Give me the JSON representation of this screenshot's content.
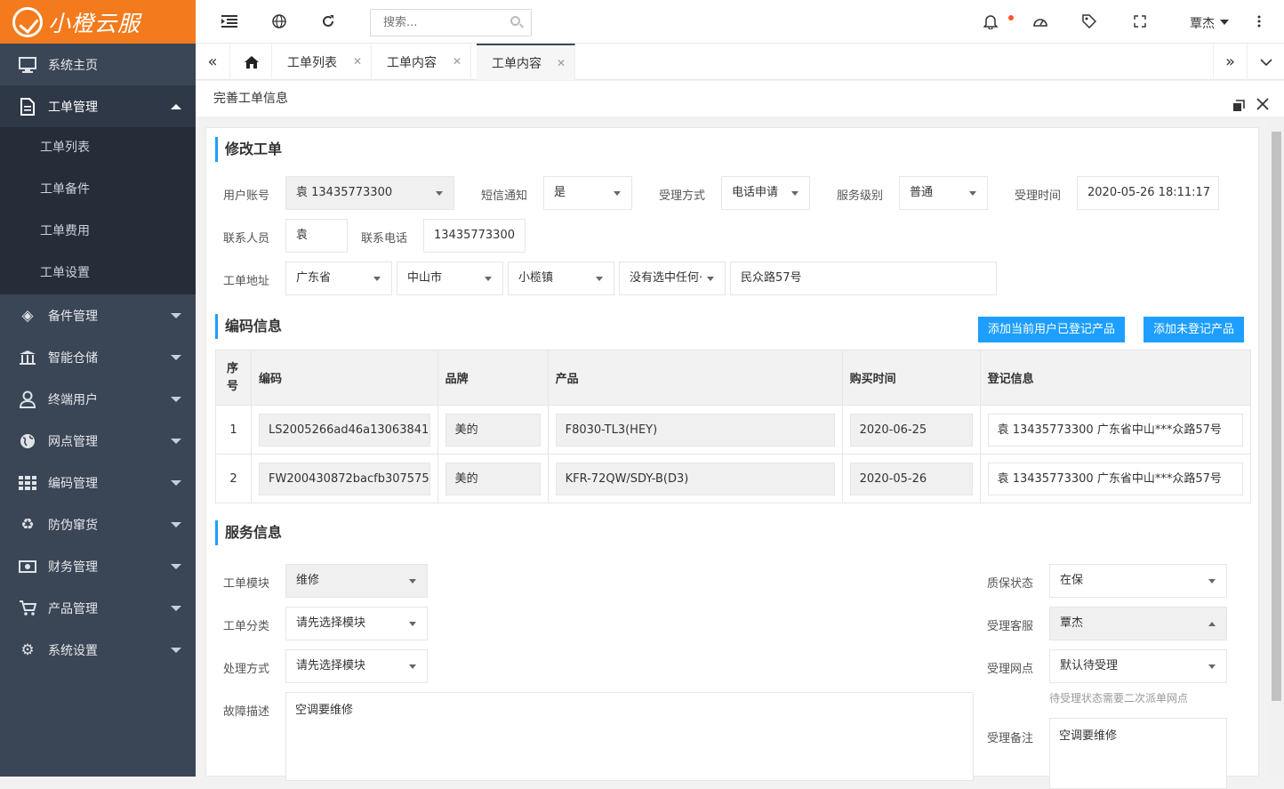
{
  "app": {
    "logo_text": "小橙云服"
  },
  "sidebar": {
    "items": [
      {
        "label": "系统主页",
        "icon": "monitor-icon"
      },
      {
        "label": "工单管理",
        "icon": "document-icon"
      },
      {
        "label": "备件管理",
        "icon": "sparepart-icon"
      },
      {
        "label": "智能仓储",
        "icon": "warehouse-icon"
      },
      {
        "label": "终端用户",
        "icon": "user-icon"
      },
      {
        "label": "网点管理",
        "icon": "globe-icon"
      },
      {
        "label": "编码管理",
        "icon": "grid-icon"
      },
      {
        "label": "防伪窜货",
        "icon": "recycle-icon"
      },
      {
        "label": "财务管理",
        "icon": "money-icon"
      },
      {
        "label": "产品管理",
        "icon": "cart-icon"
      },
      {
        "label": "系统设置",
        "icon": "gear-icon"
      }
    ],
    "sub_items": [
      "工单列表",
      "工单备件",
      "工单费用",
      "工单设置"
    ]
  },
  "topbar": {
    "search_placeholder": "搜索...",
    "user_name": "覃杰"
  },
  "tabs": [
    {
      "label": "工单列表"
    },
    {
      "label": "工单内容"
    },
    {
      "label": "工单内容",
      "active": true
    }
  ],
  "page": {
    "title": "完善工单信息"
  },
  "section_edit": {
    "title": "修改工单",
    "fields": {
      "user_account_label": "用户账号",
      "user_account_value": "袁 13435773300",
      "sms_label": "短信通知",
      "sms_value": "是",
      "accept_method_label": "受理方式",
      "accept_method_value": "电话申请",
      "service_level_label": "服务级别",
      "service_level_value": "普通",
      "accept_time_label": "受理时间",
      "accept_time_value": "2020-05-26 18:11:17",
      "contact_label": "联系人员",
      "contact_value": "袁",
      "phone_label": "联系电话",
      "phone_value": "13435773300",
      "address_label": "工单地址",
      "province": "广东省",
      "city": "中山市",
      "town": "小榄镇",
      "village": "没有选中任何·",
      "street": "民众路57号"
    }
  },
  "section_codes": {
    "title": "编码信息",
    "btn_add_registered": "添加当前用户已登记产品",
    "btn_add_unregistered": "添加未登记产品",
    "columns": [
      "序号",
      "编码",
      "品牌",
      "产品",
      "购买时间",
      "登记信息"
    ],
    "rows": [
      {
        "no": "1",
        "code": "LS2005266ad46a13063841",
        "brand": "美的",
        "product": "F8030-TL3(HEY)",
        "date": "2020-06-25",
        "reg": "袁  13435773300  广东省中山***众路57号"
      },
      {
        "no": "2",
        "code": "FW200430872bacfb307575",
        "brand": "美的",
        "product": "KFR-72QW/SDY-B(D3)",
        "date": "2020-05-26",
        "reg": "袁  13435773300  广东省中山***众路57号"
      }
    ]
  },
  "section_service": {
    "title": "服务信息",
    "module_label": "工单模块",
    "module_value": "维修",
    "category_label": "工单分类",
    "category_value": "请先选择模块",
    "handling_label": "处理方式",
    "handling_value": "请先选择模块",
    "fault_label": "故障描述",
    "fault_value": "空调要维修",
    "warranty_label": "质保状态",
    "warranty_value": "在保",
    "agent_label": "受理客服",
    "agent_value": "覃杰",
    "outlet_label": "受理网点",
    "outlet_value": "默认待受理",
    "outlet_hint": "待受理状态需要二次派单网点",
    "remark_label": "受理备注",
    "remark_value": "空调要维修"
  }
}
